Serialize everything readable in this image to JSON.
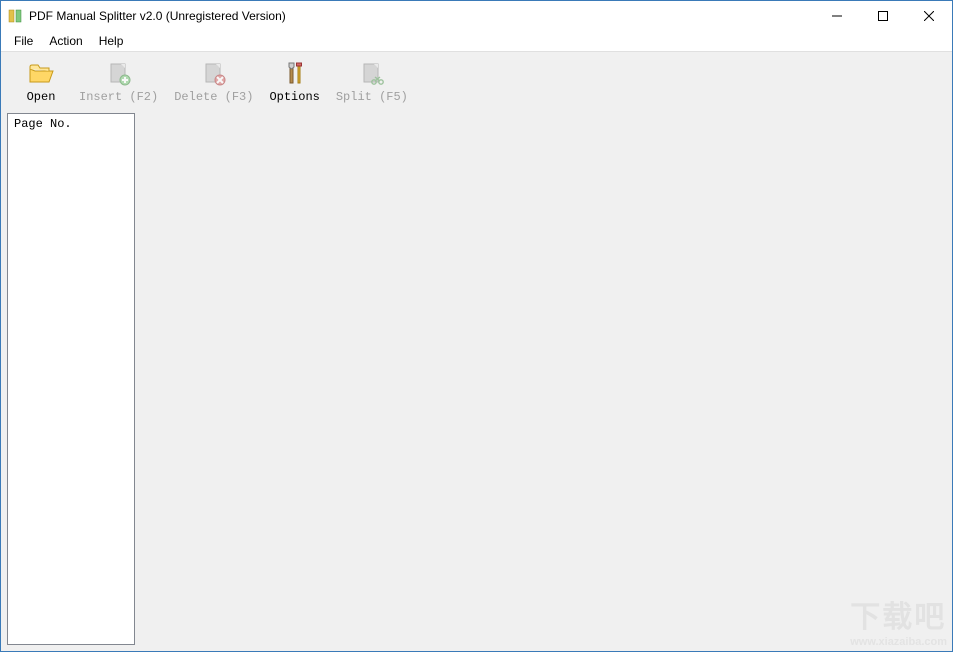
{
  "window": {
    "title": "PDF Manual Splitter v2.0 (Unregistered Version)"
  },
  "menubar": {
    "items": [
      "File",
      "Action",
      "Help"
    ]
  },
  "toolbar": {
    "open": {
      "label": "Open",
      "enabled": true
    },
    "insert": {
      "label": "Insert (F2)",
      "enabled": false
    },
    "delete": {
      "label": "Delete (F3)",
      "enabled": false
    },
    "options": {
      "label": "Options",
      "enabled": true
    },
    "split": {
      "label": "Split (F5)",
      "enabled": false
    }
  },
  "sidebar": {
    "header": "Page No."
  },
  "watermark": {
    "main": "下载吧",
    "sub": "www.xiazaiba.com"
  }
}
